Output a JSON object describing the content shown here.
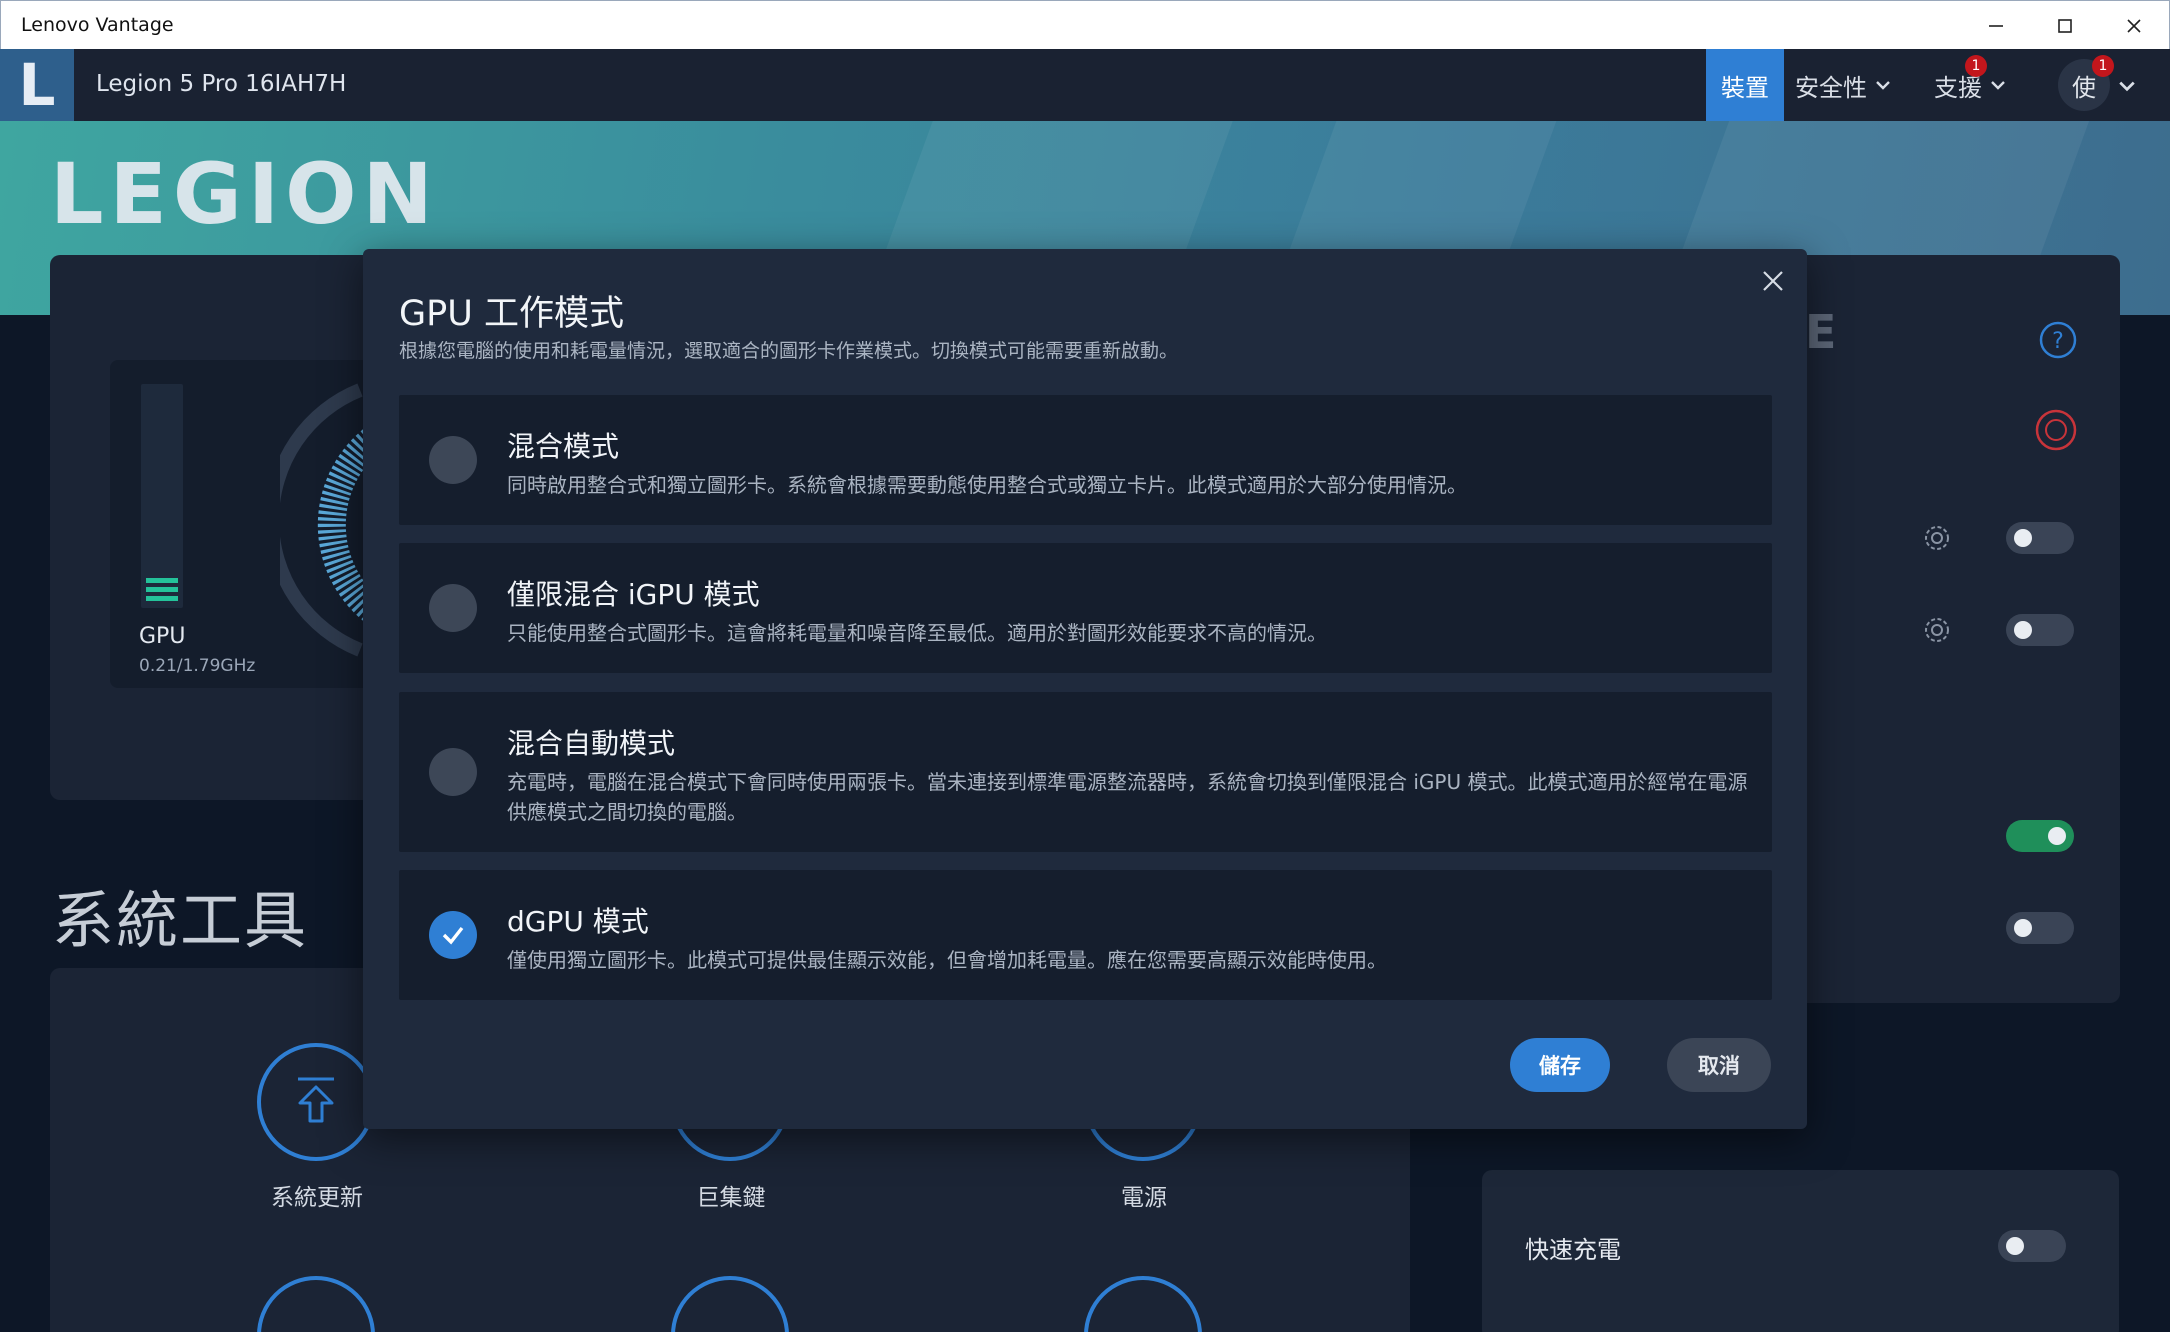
{
  "window": {
    "title": "Lenovo Vantage"
  },
  "header": {
    "logo_letter": "L",
    "device_name": "Legion 5 Pro 16IAH7H",
    "nav": [
      {
        "label": "裝置",
        "active": true
      },
      {
        "label": "安全性",
        "has_dropdown": true
      },
      {
        "label": "支援",
        "has_dropdown": true,
        "badge": "1"
      },
      {
        "label": "使",
        "has_dropdown": true,
        "badge": "1"
      }
    ]
  },
  "banner": {
    "brand": "LEGION"
  },
  "background": {
    "gpu": {
      "label": "GPU",
      "frequency": "0.21/1.79GHz"
    },
    "partial_heading_letter": "E",
    "section_title": "系統工具",
    "tools": [
      "系統更新",
      "巨集鍵",
      "電源"
    ],
    "toggles": [
      false,
      false,
      true,
      false
    ],
    "quick_settings": [
      {
        "label": "快速充電",
        "enabled": false
      }
    ]
  },
  "dialog": {
    "title": "GPU 工作模式",
    "description": "根據您電腦的使用和耗電量情況，選取適合的圖形卡作業模式。切換模式可能需要重新啟動。",
    "options": [
      {
        "name": "混合模式",
        "description": "同時啟用整合式和獨立圖形卡。系統會根據需要動態使用整合式或獨立卡片。此模式適用於大部分使用情況。",
        "selected": false
      },
      {
        "name": "僅限混合 iGPU 模式",
        "description": "只能使用整合式圖形卡。這會將耗電量和噪音降至最低。適用於對圖形效能要求不高的情況。",
        "selected": false
      },
      {
        "name": "混合自動模式",
        "description": "充電時，電腦在混合模式下會同時使用兩張卡。當未連接到標準電源整流器時，系統會切換到僅限混合 iGPU 模式。此模式適用於經常在電源供應模式之間切換的電腦。",
        "selected": false
      },
      {
        "name": "dGPU 模式",
        "description": "僅使用獨立圖形卡。此模式可提供最佳顯示效能，但會增加耗電量。應在您需要高顯示效能時使用。",
        "selected": true
      }
    ],
    "save_label": "儲存",
    "cancel_label": "取消"
  },
  "colors": {
    "accent": "#2f7fd4",
    "badge": "#c3161c",
    "toggle_on": "#1f8f5a"
  }
}
